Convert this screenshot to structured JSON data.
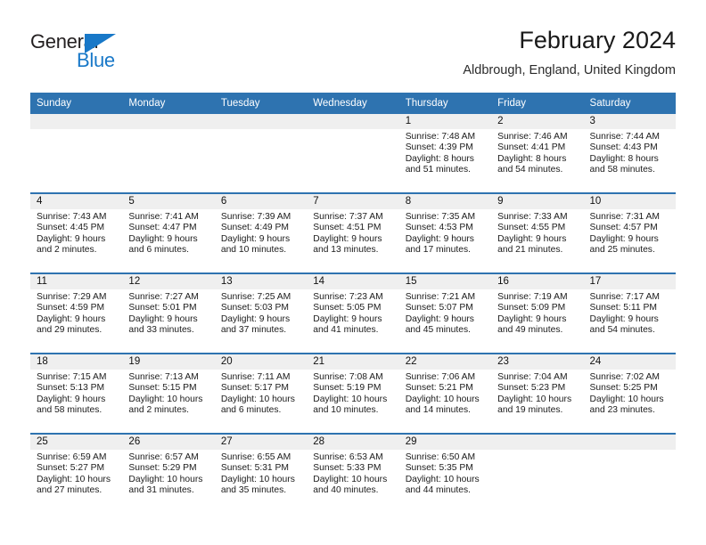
{
  "brand": {
    "name_part1": "General",
    "name_part2": "Blue",
    "triangle_icon": "blue-triangle-flag-icon",
    "accent_color": "#1878c8"
  },
  "header": {
    "title": "February 2024",
    "subtitle": "Aldbrough, England, United Kingdom"
  },
  "theme": {
    "header_blue": "#2e73b0",
    "daynum_band": "#efefef",
    "cell_background": "#ffffff"
  },
  "weekdays": [
    "Sunday",
    "Monday",
    "Tuesday",
    "Wednesday",
    "Thursday",
    "Friday",
    "Saturday"
  ],
  "weeks": [
    [
      {
        "day": "",
        "sunrise": "",
        "sunset": "",
        "daylight_line1": "",
        "daylight_line2": ""
      },
      {
        "day": "",
        "sunrise": "",
        "sunset": "",
        "daylight_line1": "",
        "daylight_line2": ""
      },
      {
        "day": "",
        "sunrise": "",
        "sunset": "",
        "daylight_line1": "",
        "daylight_line2": ""
      },
      {
        "day": "",
        "sunrise": "",
        "sunset": "",
        "daylight_line1": "",
        "daylight_line2": ""
      },
      {
        "day": "1",
        "sunrise": "Sunrise: 7:48 AM",
        "sunset": "Sunset: 4:39 PM",
        "daylight_line1": "Daylight: 8 hours",
        "daylight_line2": "and 51 minutes."
      },
      {
        "day": "2",
        "sunrise": "Sunrise: 7:46 AM",
        "sunset": "Sunset: 4:41 PM",
        "daylight_line1": "Daylight: 8 hours",
        "daylight_line2": "and 54 minutes."
      },
      {
        "day": "3",
        "sunrise": "Sunrise: 7:44 AM",
        "sunset": "Sunset: 4:43 PM",
        "daylight_line1": "Daylight: 8 hours",
        "daylight_line2": "and 58 minutes."
      }
    ],
    [
      {
        "day": "4",
        "sunrise": "Sunrise: 7:43 AM",
        "sunset": "Sunset: 4:45 PM",
        "daylight_line1": "Daylight: 9 hours",
        "daylight_line2": "and 2 minutes."
      },
      {
        "day": "5",
        "sunrise": "Sunrise: 7:41 AM",
        "sunset": "Sunset: 4:47 PM",
        "daylight_line1": "Daylight: 9 hours",
        "daylight_line2": "and 6 minutes."
      },
      {
        "day": "6",
        "sunrise": "Sunrise: 7:39 AM",
        "sunset": "Sunset: 4:49 PM",
        "daylight_line1": "Daylight: 9 hours",
        "daylight_line2": "and 10 minutes."
      },
      {
        "day": "7",
        "sunrise": "Sunrise: 7:37 AM",
        "sunset": "Sunset: 4:51 PM",
        "daylight_line1": "Daylight: 9 hours",
        "daylight_line2": "and 13 minutes."
      },
      {
        "day": "8",
        "sunrise": "Sunrise: 7:35 AM",
        "sunset": "Sunset: 4:53 PM",
        "daylight_line1": "Daylight: 9 hours",
        "daylight_line2": "and 17 minutes."
      },
      {
        "day": "9",
        "sunrise": "Sunrise: 7:33 AM",
        "sunset": "Sunset: 4:55 PM",
        "daylight_line1": "Daylight: 9 hours",
        "daylight_line2": "and 21 minutes."
      },
      {
        "day": "10",
        "sunrise": "Sunrise: 7:31 AM",
        "sunset": "Sunset: 4:57 PM",
        "daylight_line1": "Daylight: 9 hours",
        "daylight_line2": "and 25 minutes."
      }
    ],
    [
      {
        "day": "11",
        "sunrise": "Sunrise: 7:29 AM",
        "sunset": "Sunset: 4:59 PM",
        "daylight_line1": "Daylight: 9 hours",
        "daylight_line2": "and 29 minutes."
      },
      {
        "day": "12",
        "sunrise": "Sunrise: 7:27 AM",
        "sunset": "Sunset: 5:01 PM",
        "daylight_line1": "Daylight: 9 hours",
        "daylight_line2": "and 33 minutes."
      },
      {
        "day": "13",
        "sunrise": "Sunrise: 7:25 AM",
        "sunset": "Sunset: 5:03 PM",
        "daylight_line1": "Daylight: 9 hours",
        "daylight_line2": "and 37 minutes."
      },
      {
        "day": "14",
        "sunrise": "Sunrise: 7:23 AM",
        "sunset": "Sunset: 5:05 PM",
        "daylight_line1": "Daylight: 9 hours",
        "daylight_line2": "and 41 minutes."
      },
      {
        "day": "15",
        "sunrise": "Sunrise: 7:21 AM",
        "sunset": "Sunset: 5:07 PM",
        "daylight_line1": "Daylight: 9 hours",
        "daylight_line2": "and 45 minutes."
      },
      {
        "day": "16",
        "sunrise": "Sunrise: 7:19 AM",
        "sunset": "Sunset: 5:09 PM",
        "daylight_line1": "Daylight: 9 hours",
        "daylight_line2": "and 49 minutes."
      },
      {
        "day": "17",
        "sunrise": "Sunrise: 7:17 AM",
        "sunset": "Sunset: 5:11 PM",
        "daylight_line1": "Daylight: 9 hours",
        "daylight_line2": "and 54 minutes."
      }
    ],
    [
      {
        "day": "18",
        "sunrise": "Sunrise: 7:15 AM",
        "sunset": "Sunset: 5:13 PM",
        "daylight_line1": "Daylight: 9 hours",
        "daylight_line2": "and 58 minutes."
      },
      {
        "day": "19",
        "sunrise": "Sunrise: 7:13 AM",
        "sunset": "Sunset: 5:15 PM",
        "daylight_line1": "Daylight: 10 hours",
        "daylight_line2": "and 2 minutes."
      },
      {
        "day": "20",
        "sunrise": "Sunrise: 7:11 AM",
        "sunset": "Sunset: 5:17 PM",
        "daylight_line1": "Daylight: 10 hours",
        "daylight_line2": "and 6 minutes."
      },
      {
        "day": "21",
        "sunrise": "Sunrise: 7:08 AM",
        "sunset": "Sunset: 5:19 PM",
        "daylight_line1": "Daylight: 10 hours",
        "daylight_line2": "and 10 minutes."
      },
      {
        "day": "22",
        "sunrise": "Sunrise: 7:06 AM",
        "sunset": "Sunset: 5:21 PM",
        "daylight_line1": "Daylight: 10 hours",
        "daylight_line2": "and 14 minutes."
      },
      {
        "day": "23",
        "sunrise": "Sunrise: 7:04 AM",
        "sunset": "Sunset: 5:23 PM",
        "daylight_line1": "Daylight: 10 hours",
        "daylight_line2": "and 19 minutes."
      },
      {
        "day": "24",
        "sunrise": "Sunrise: 7:02 AM",
        "sunset": "Sunset: 5:25 PM",
        "daylight_line1": "Daylight: 10 hours",
        "daylight_line2": "and 23 minutes."
      }
    ],
    [
      {
        "day": "25",
        "sunrise": "Sunrise: 6:59 AM",
        "sunset": "Sunset: 5:27 PM",
        "daylight_line1": "Daylight: 10 hours",
        "daylight_line2": "and 27 minutes."
      },
      {
        "day": "26",
        "sunrise": "Sunrise: 6:57 AM",
        "sunset": "Sunset: 5:29 PM",
        "daylight_line1": "Daylight: 10 hours",
        "daylight_line2": "and 31 minutes."
      },
      {
        "day": "27",
        "sunrise": "Sunrise: 6:55 AM",
        "sunset": "Sunset: 5:31 PM",
        "daylight_line1": "Daylight: 10 hours",
        "daylight_line2": "and 35 minutes."
      },
      {
        "day": "28",
        "sunrise": "Sunrise: 6:53 AM",
        "sunset": "Sunset: 5:33 PM",
        "daylight_line1": "Daylight: 10 hours",
        "daylight_line2": "and 40 minutes."
      },
      {
        "day": "29",
        "sunrise": "Sunrise: 6:50 AM",
        "sunset": "Sunset: 5:35 PM",
        "daylight_line1": "Daylight: 10 hours",
        "daylight_line2": "and 44 minutes."
      },
      {
        "day": "",
        "sunrise": "",
        "sunset": "",
        "daylight_line1": "",
        "daylight_line2": ""
      },
      {
        "day": "",
        "sunrise": "",
        "sunset": "",
        "daylight_line1": "",
        "daylight_line2": ""
      }
    ]
  ]
}
